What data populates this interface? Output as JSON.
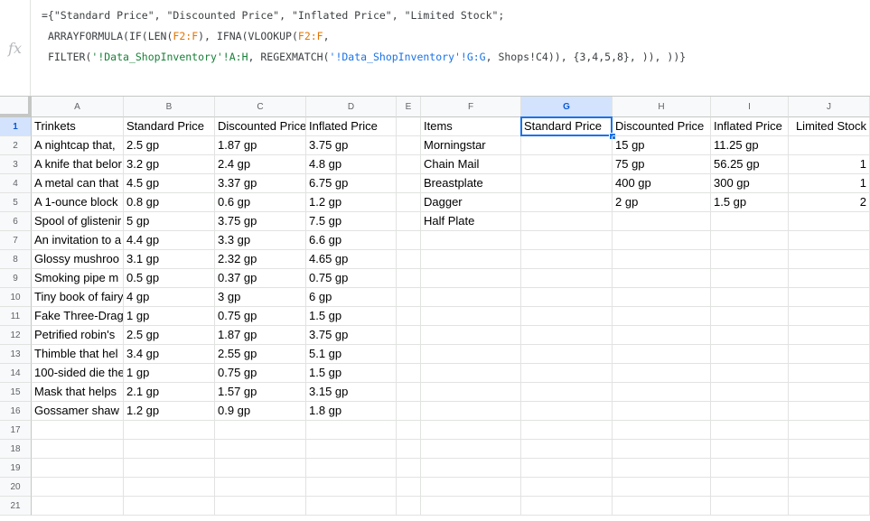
{
  "formula": {
    "fx_label": "fx",
    "line1": "={\"Standard Price\", \"Discounted Price\", \"Inflated Price\", \"Limited Stock\";",
    "line2_a": "ARRAYFORMULA(IF(LEN(",
    "line2_ref1": "F2:F",
    "line2_b": "), IFNA(VLOOKUP(",
    "line2_ref2": "F2:F",
    "line2_c": ",",
    "line3_a": "FILTER(",
    "line3_s1": "'!Data_ShopInventory'!A:H",
    "line3_b": ", REGEXMATCH(",
    "line3_s2": "'!Data_ShopInventory'!G:G",
    "line3_c": ", Shops!C4)), {3,4,5,8}, )), ))}"
  },
  "columns": [
    {
      "label": "A",
      "width": 102
    },
    {
      "label": "B",
      "width": 101
    },
    {
      "label": "C",
      "width": 101
    },
    {
      "label": "D",
      "width": 100
    },
    {
      "label": "E",
      "width": 27
    },
    {
      "label": "F",
      "width": 111
    },
    {
      "label": "G",
      "width": 101
    },
    {
      "label": "H",
      "width": 109
    },
    {
      "label": "I",
      "width": 86
    },
    {
      "label": "J",
      "width": 90
    }
  ],
  "selected_column": "G",
  "selected_row": 1,
  "row_numbers": [
    "1",
    "2",
    "3",
    "4",
    "5",
    "6",
    "7",
    "8",
    "9",
    "10",
    "11",
    "12",
    "13",
    "14",
    "15",
    "16",
    "17",
    "18",
    "19",
    "20",
    "21"
  ],
  "rows": [
    [
      "Trinkets",
      "Standard Price",
      "Discounted Price",
      "Inflated Price",
      "",
      "Items",
      "Standard Price",
      "Discounted Price",
      "Inflated Price",
      "Limited Stock"
    ],
    [
      "A nightcap that, ",
      "2.5 gp",
      "1.87 gp",
      "3.75 gp",
      "",
      "Morningstar",
      "",
      "15 gp",
      "11.25 gp",
      ""
    ],
    [
      "A knife that belor",
      "3.2 gp",
      "2.4 gp",
      "4.8 gp",
      "",
      "Chain Mail",
      "",
      "75 gp",
      "56.25 gp",
      "1"
    ],
    [
      "A metal can that",
      "4.5 gp",
      "3.37 gp",
      "6.75 gp",
      "",
      "Breastplate",
      "",
      "400 gp",
      "300 gp",
      "1"
    ],
    [
      "A 1-ounce block",
      "0.8 gp",
      "0.6 gp",
      "1.2 gp",
      "",
      "Dagger",
      "",
      "2 gp",
      "1.5 gp",
      "2"
    ],
    [
      "Spool of glistenir",
      "5 gp",
      "3.75 gp",
      "7.5 gp",
      "",
      "Half Plate",
      "",
      "",
      "",
      ""
    ],
    [
      "An invitation to a",
      "4.4 gp",
      "3.3 gp",
      "6.6 gp",
      "",
      "",
      "",
      "",
      "",
      ""
    ],
    [
      "Glossy mushroo",
      "3.1 gp",
      "2.32 gp",
      "4.65 gp",
      "",
      "",
      "",
      "",
      "",
      ""
    ],
    [
      "Smoking pipe m",
      "0.5 gp",
      "0.37 gp",
      "0.75 gp",
      "",
      "",
      "",
      "",
      "",
      ""
    ],
    [
      "Tiny book of fairy",
      "4 gp",
      "3 gp",
      "6 gp",
      "",
      "",
      "",
      "",
      "",
      ""
    ],
    [
      "Fake Three-Drag",
      "1 gp",
      "0.75 gp",
      "1.5 gp",
      "",
      "",
      "",
      "",
      "",
      ""
    ],
    [
      "Petrified robin's",
      "2.5 gp",
      "1.87 gp",
      "3.75 gp",
      "",
      "",
      "",
      "",
      "",
      ""
    ],
    [
      "Thimble that hel",
      "3.4 gp",
      "2.55 gp",
      "5.1 gp",
      "",
      "",
      "",
      "",
      "",
      ""
    ],
    [
      "100-sided die the",
      "1 gp",
      "0.75 gp",
      "1.5 gp",
      "",
      "",
      "",
      "",
      "",
      ""
    ],
    [
      "Mask that helps",
      "2.1 gp",
      "1.57 gp",
      "3.15 gp",
      "",
      "",
      "",
      "",
      "",
      ""
    ],
    [
      "Gossamer shaw",
      "1.2 gp",
      "0.9 gp",
      "1.8 gp",
      "",
      "",
      "",
      "",
      "",
      ""
    ],
    [
      "",
      "",
      "",
      "",
      "",
      "",
      "",
      "",
      "",
      ""
    ],
    [
      "",
      "",
      "",
      "",
      "",
      "",
      "",
      "",
      "",
      ""
    ],
    [
      "",
      "",
      "",
      "",
      "",
      "",
      "",
      "",
      "",
      ""
    ],
    [
      "",
      "",
      "",
      "",
      "",
      "",
      "",
      "",
      "",
      ""
    ],
    [
      "",
      "",
      "",
      "",
      "",
      "",
      "",
      "",
      "",
      ""
    ]
  ],
  "numeric_columns": [
    "J"
  ],
  "colors": {
    "selection": "#1a73e8",
    "header_bg": "#f8f9fa",
    "header_selected_bg": "#d3e3fd"
  }
}
